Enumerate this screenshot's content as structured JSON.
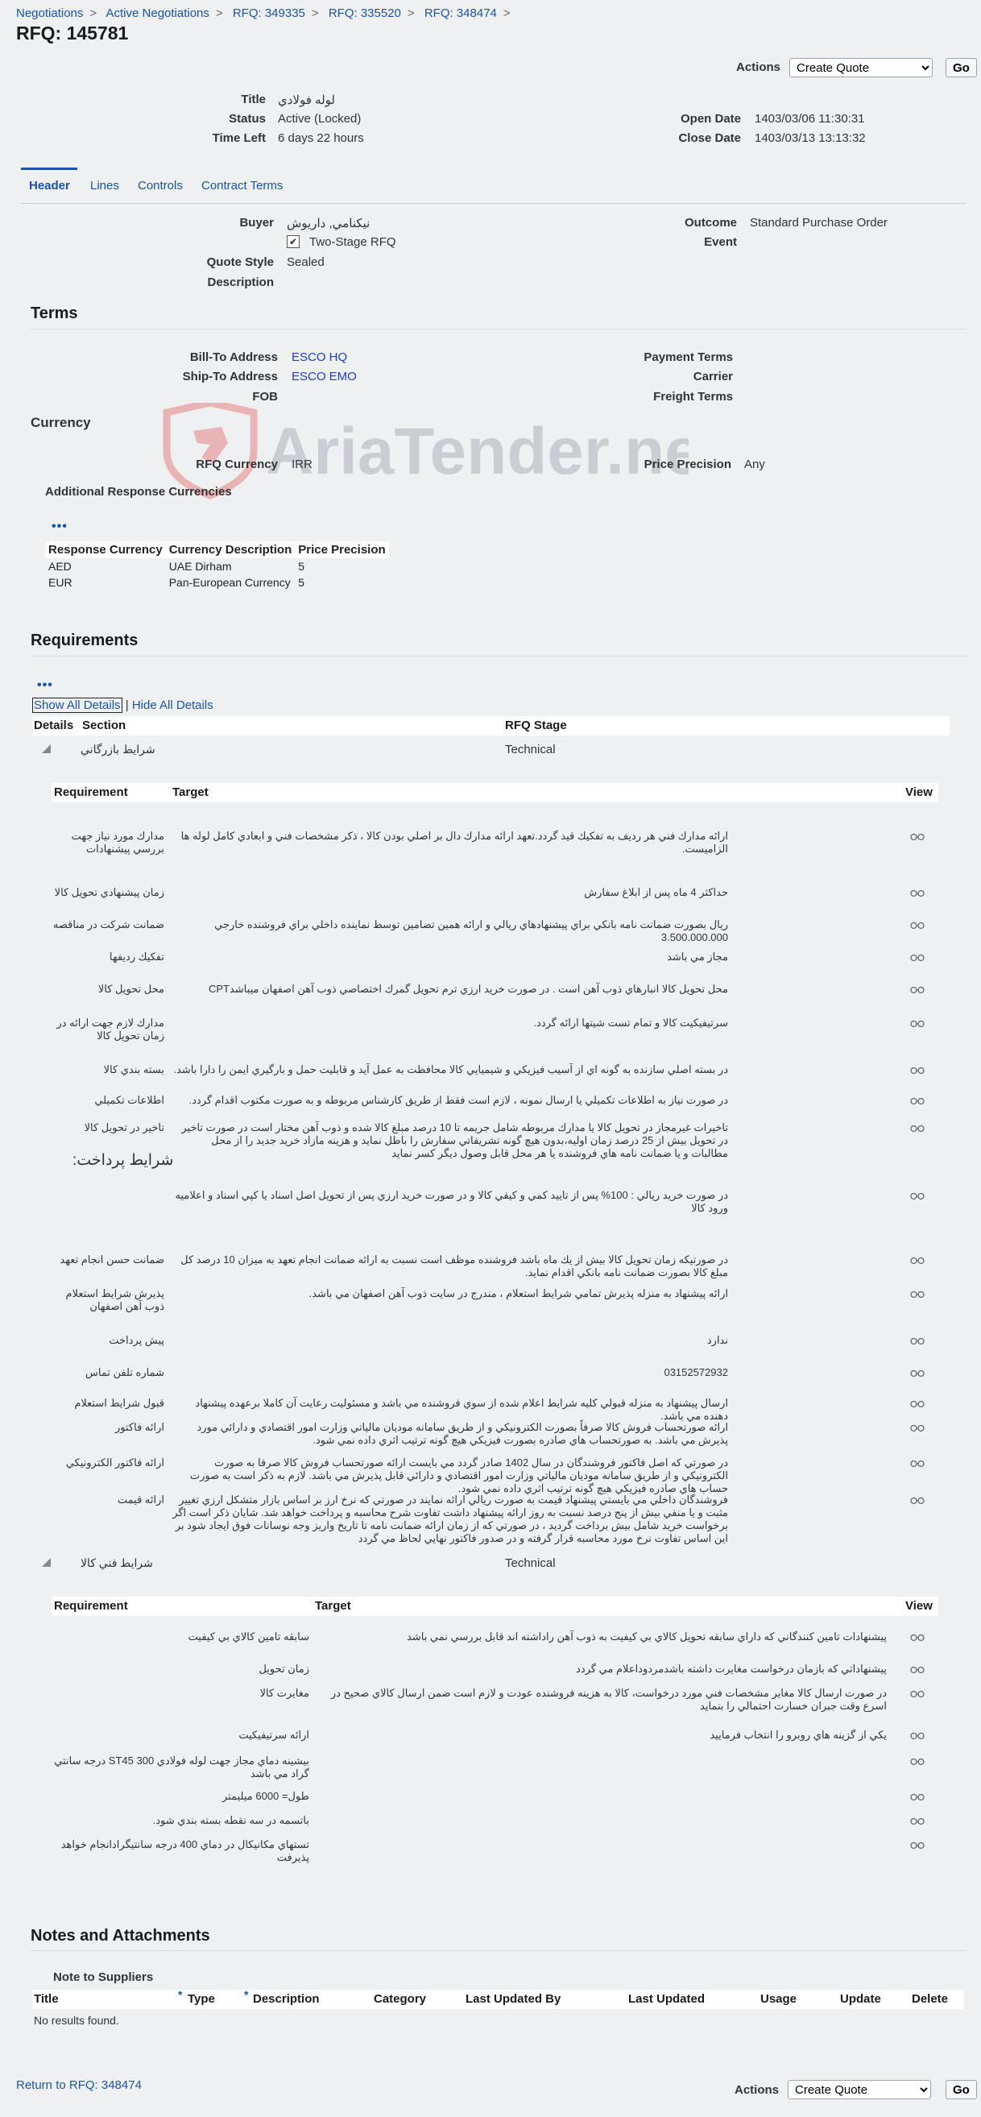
{
  "breadcrumbs": [
    "Negotiations",
    "Active Negotiations",
    "RFQ: 349335",
    "RFQ: 335520",
    "RFQ: 348474"
  ],
  "page_title": "RFQ: 145781",
  "actions": {
    "label": "Actions",
    "selected": "Create Quote",
    "go": "Go"
  },
  "summary": {
    "title_label": "Title",
    "title_value": "لوله فولادي",
    "status_label": "Status",
    "status_value": "Active (Locked)",
    "time_left_label": "Time Left",
    "time_left_value": "6 days 22 hours",
    "open_date_label": "Open Date",
    "open_date_value": "1403/03/06 11:30:31",
    "close_date_label": "Close Date",
    "close_date_value": "1403/03/13 13:13:32"
  },
  "tabs": [
    "Header",
    "Lines",
    "Controls",
    "Contract Terms"
  ],
  "header": {
    "buyer_label": "Buyer",
    "buyer_value": "نيکنامي, داريوش",
    "two_stage_label": "Two-Stage RFQ",
    "quote_style_label": "Quote Style",
    "quote_style_value": "Sealed",
    "description_label": "Description",
    "outcome_label": "Outcome",
    "outcome_value": "Standard Purchase Order",
    "event_label": "Event"
  },
  "terms": {
    "heading": "Terms",
    "bill_to_label": "Bill-To Address",
    "bill_to_value": "ESCO HQ",
    "ship_to_label": "Ship-To Address",
    "ship_to_value": "ESCO EMO",
    "fob_label": "FOB",
    "payment_terms_label": "Payment Terms",
    "carrier_label": "Carrier",
    "freight_terms_label": "Freight Terms"
  },
  "currency": {
    "heading": "Currency",
    "rfq_currency_label": "RFQ Currency",
    "rfq_currency_value": "IRR",
    "price_precision_label": "Price Precision",
    "price_precision_value": "Any",
    "additional_heading": "Additional Response Currencies",
    "columns": [
      "Response Currency",
      "Currency Description",
      "Price Precision"
    ],
    "rows": [
      [
        "AED",
        "UAE Dirham",
        "5"
      ],
      [
        "EUR",
        "Pan-European Currency",
        "5"
      ]
    ]
  },
  "requirements": {
    "heading": "Requirements",
    "show_all": "Show All Details",
    "hide_all": "Hide All Details",
    "columns": [
      "Details",
      "Section",
      "RFQ Stage"
    ],
    "sub_columns": [
      "Requirement",
      "Target",
      "View"
    ],
    "section1": {
      "name": "شرايط بازرگاني",
      "stage": "Technical"
    },
    "section2": {
      "name": "شرايط فني كالا",
      "stage": "Technical"
    },
    "rows1": [
      {
        "req": "مدارك مورد نياز جهت بررسي پيشنهادات",
        "target": "ارائه مدارك فني هر رديف به تفكيك قيد گردد.تعهد ارائه مدارك دال بر اصلي بودن كالا ، ذكر مشخصات فني و ابعادي كامل لوله ها الزاميست."
      },
      {
        "req": "زمان پيشنهادي تحويل كالا",
        "target": "حداكثر 4 ماه پس از ابلاغ سفارش"
      },
      {
        "req": "ضمانت شركت در مناقصه",
        "target": "ريال بصورت ضمانت نامه بانكي براي پيشنهادهاي ريالي و ارائه همين تضامين توسط نماينده داخلي براي فروشنده خارجي 3.500.000.000"
      },
      {
        "req": "تفكيك رديفها",
        "target": "مجاز مي باشد"
      },
      {
        "req": "محل تحويل كالا",
        "target": "محل تحويل كالا انبارهاي ذوب آهن است . در صورت خريد ارزي ترم تحويل گمرك اختصاصي ذوب آهن اصفهان ميباشدCPT"
      },
      {
        "req": "مدارك لازم جهت ارائه در زمان تحويل كالا",
        "target": "سرتيفيكيت كالا و تمام تست شيتها ارائه گردد."
      },
      {
        "req": "بسته بندي كالا",
        "target": "در بسته اصلي سازنده به گونه اي از آسيب فيزيكي و شيميايي كالا محافظت به عمل آيد و قابليت حمل و بارگيري ايمن را دارا باشد."
      },
      {
        "req": "اطلاعات تكميلي",
        "target": "در صورت نياز به اطلاعات تكميلي يا ارسال نمونه ، لازم است فقط از طريق كارشناس مربوطه و به صورت مكتوب اقدام گردد."
      },
      {
        "req": "تاخير در تحويل كالا",
        "target": "تاخيرات غيرمجاز در تحويل كالا يا مدارك مربوطه شامل جريمه تا 10 درصد مبلغ كالا شده و ذوب آهن مختار است در صورت تاخير در تحويل بيش از 25 درصد زمان اوليه،بدون هيچ گونه تشريفاتي سفارش را باطل نمايد و هزينه مازاد خريد جديد را از محل مطالبات و يا ضمانت نامه هاي فروشنده يا هر محل قابل وصول ديگر كسر نمايد"
      },
      {
        "req": "شرايط پرداخت:",
        "target": "در صورت خريد ريالي : 100% پس از تاييد كمي و كيفي كالا و در صورت خريد ارزي پس از تحويل اصل اسناد يا كپي اسناد و اعلاميه ورود كالا"
      },
      {
        "req": "ضمانت حسن انجام تعهد",
        "target": "در صورتيكه زمان تحويل كالا بيش از يك ماه باشد فروشنده موظف است نسبت به ارائه ضمانت انجام تعهد به ميزان 10 درصد كل مبلغ كالا بصورت ضمانت نامه بانكي اقدام نمايد."
      },
      {
        "req": "پذيرش شرايط استعلام ذوب آهن اصفهان",
        "target": "ارائه پيشنهاد به منزله پذيرش تمامي شرايط استعلام ، مندرج در سايت ذوب آهن اصفهان مي باشد."
      },
      {
        "req": "پيش پرداخت",
        "target": "ندارد"
      },
      {
        "req": "شماره تلفن تماس",
        "target": "03152572932"
      },
      {
        "req": "قبول شرايط استعلام",
        "target": "ارسال پيشنهاد به منزله قبولي كليه شرايط اعلام شده از سوي فروشنده مي باشد و مسئوليت رعايت آن كاملا برعهده پيشنهاد دهنده مي باشد."
      },
      {
        "req": "ارائه فاكتور",
        "target": "ارائه صورتحساب فروش كالا صرفاً بصورت الكترونيكي و از طريق سامانه موديان مالياتي وزارت امور اقتصادي و دارائي مورد پذيرش مي باشد. به صورتحساب هاي صادره بصورت فيزيكي هيچ گونه ترتيب اثري داده نمي شود."
      },
      {
        "req": "ارائه فاكتور الكترونيكي",
        "target": "در صورتي كه اصل فاكتور فروشندگان در سال 1402 صادر گردد مي بايست ارائه صورتحساب فروش كالا صرفا به صورت الكترونيكي و از طريق سامانه موديان مالياتي وزارت امور اقتصادي و دارائي قابل پذيرش مي باشد. لازم به ذكر است به صورت حساب هاي صادره فيزيكي هيچ گونه ترتيب اثري داده نمي شود."
      },
      {
        "req": "ارائه قيمت",
        "target": "فروشندگان داخلي مي بايستي پيشنهاد قيمت به صورت ريالي ارائه نمايند در صورتي كه نرخ ارز بر اساس بازار متشكل ارزي تغيير مثبت و يا منفي بيش از پنج درصد نسبت به روز ارائه پيشنهاد داشت تفاوت شرح محاسبه و پرداخت خواهد شد. شايان ذكر است اگر برخواست خريد شامل بيش برداخت گرديد ، در صورتي كه از زمان ارائه ضمانت نامه تا تاريخ واريز وجه نوسانات فوق ايجاد شود بر اين اساس تفاوت نرخ مورد محاسبه قرار گرفته و در صدور فاكتور نهايي لحاظ مي گردد"
      }
    ],
    "rows2": [
      {
        "req": "سابقه تامين كالاي بي كيفيت",
        "target": "پيشنهادات تامين كنندگاني كه داراي سابقه تحويل كالاي بي كيفيت به ذوب آهن راداشته اند قابل بررسي نمي باشد"
      },
      {
        "req": "زمان تحويل",
        "target": "پيشنهاداتي كه بازمان درخواست مغايرت داشته باشدمردوداعلام مي گردد"
      },
      {
        "req": "مغايرت كالا",
        "target": "در صورت ارسال كالا مغاير مشخصات فني مورد درخواست، كالا به هزينه فروشنده عودت و لازم است ضمن ارسال كالاي صحيح در اسرع وقت جبران خسارت احتمالي را بنمايد"
      },
      {
        "req": "ارائه سرتيفيكيت",
        "target": "يكي از گزينه هاي روبرو را انتخاب فرماييد"
      },
      {
        "req": "بيشينه دماي مجاز جهت لوله فولادي ST45 300 درجه سانتي گراد مي باشد",
        "target": ""
      },
      {
        "req": "طول= 6000 ميليمتر",
        "target": ""
      },
      {
        "req": "باتسمه در سه نقطه بسته بندي شود.",
        "target": ""
      },
      {
        "req": "تستهاي مكانيكال در دماي 400 درجه سانتيگرادانجام خواهد پذيرفت",
        "target": ""
      }
    ],
    "view_icon": "glasses-icon"
  },
  "notes": {
    "heading": "Notes and Attachments",
    "sub_heading": "Note to Suppliers",
    "columns": [
      "Title",
      "Type",
      "Description",
      "Category",
      "Last Updated By",
      "Last Updated",
      "Usage",
      "Update",
      "Delete"
    ],
    "empty": "No results found."
  },
  "footer": {
    "return_link": "Return to RFQ: 348474"
  },
  "watermark_text": "AriaTender.neT"
}
